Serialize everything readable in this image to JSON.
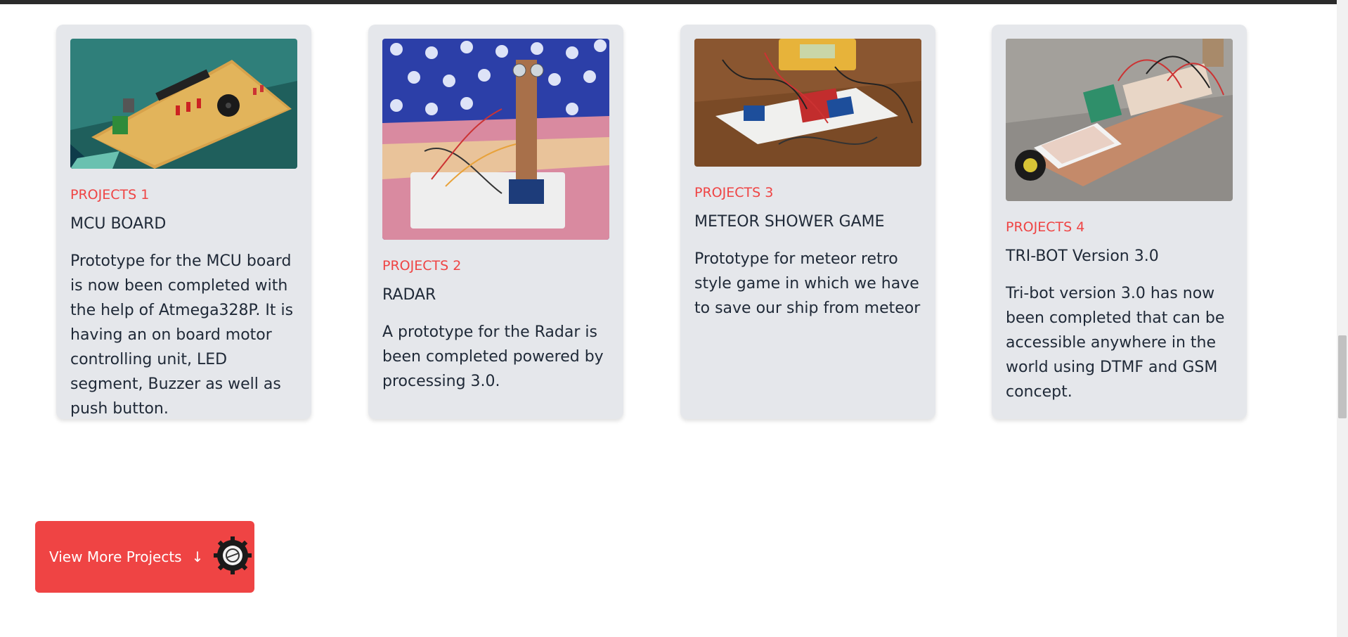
{
  "projects": [
    {
      "tag": "PROJECTS 1",
      "title": "MCU BOARD",
      "description": "Prototype for the MCU board is now been completed with the help of Atmega328P. It is having an on board motor controlling unit, LED segment, Buzzer as well as push button."
    },
    {
      "tag": "PROJECTS 2",
      "title": "RADAR",
      "description": "A prototype for the Radar is been completed powered by processing 3.0."
    },
    {
      "tag": "PROJECTS 3",
      "title": "METEOR SHOWER GAME",
      "description": "Prototype for meteor retro style game in which we have to save our ship from meteor"
    },
    {
      "tag": "PROJECTS 4",
      "title": "TRI-BOT Version 3.0",
      "description": "Tri-bot version 3.0 has now been completed that can be accessible anywhere in the world using DTMF and GSM concept."
    }
  ],
  "cta": {
    "label": "View More Projects",
    "arrow_icon": "arrow-down-icon",
    "logo_icon": "gear-logo-icon"
  },
  "colors": {
    "accent": "#ef4444",
    "card_bg": "#e5e7eb",
    "text": "#1f2937"
  }
}
